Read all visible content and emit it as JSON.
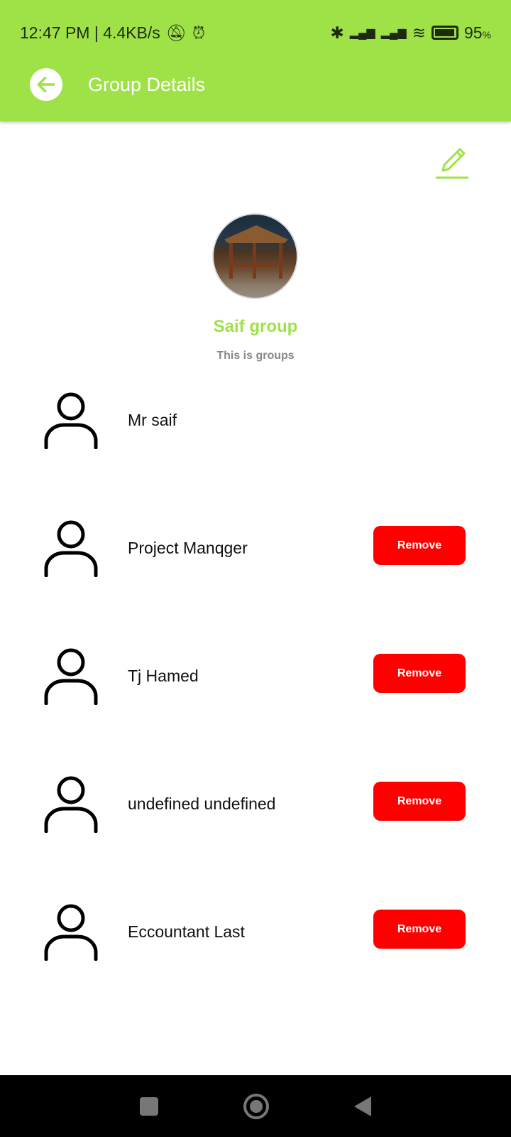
{
  "status": {
    "time": "12:47 PM | 4.4KB/s",
    "battery": "95",
    "battery_unit": "%"
  },
  "header": {
    "title": "Group Details"
  },
  "group": {
    "name": "Saif group",
    "description": "This is groups"
  },
  "members": [
    {
      "name": "Mr saif",
      "removable": false
    },
    {
      "name": "Project Manqger",
      "removable": true
    },
    {
      "name": "Tj Hamed",
      "removable": true
    },
    {
      "name": "undefined undefined",
      "removable": true
    },
    {
      "name": "Eccountant Last",
      "removable": true
    }
  ],
  "remove_label": "Remove",
  "colors": {
    "primary": "#9fe247",
    "danger": "#fe0000"
  }
}
